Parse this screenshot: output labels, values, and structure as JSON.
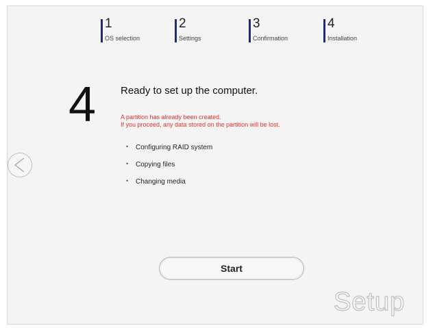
{
  "steps": [
    {
      "number": "1",
      "label": "OS selection"
    },
    {
      "number": "2",
      "label": "Settings"
    },
    {
      "number": "3",
      "label": "Confirmation"
    },
    {
      "number": "4",
      "label": "Installation"
    }
  ],
  "current_step": "4",
  "title": "Ready to set up the computer.",
  "warning": {
    "line1": "A partition has already been created.",
    "line2": "If you proceed, any data stored on the partition will be lost."
  },
  "tasks": [
    "Configuring RAID system",
    "Copying files",
    "Changing media"
  ],
  "buttons": {
    "start": "Start"
  },
  "watermark": "Setup",
  "colors": {
    "step_bar": "#1e2a7a",
    "warning": "#e53030"
  }
}
